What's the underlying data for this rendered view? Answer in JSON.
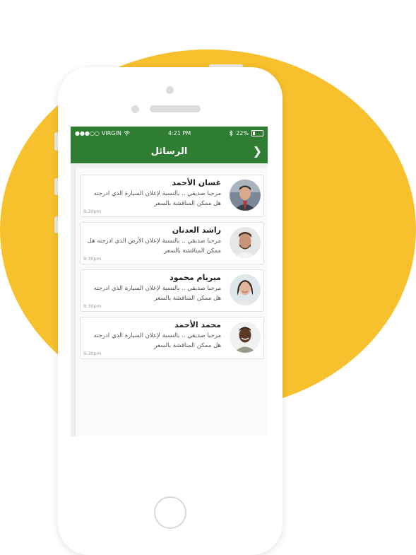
{
  "colors": {
    "accent": "#2e7d32",
    "background_circle": "#f6c12c"
  },
  "status_bar": {
    "signal": "●●●○○",
    "carrier": "VIRGIN",
    "wifi_icon": "wifi-icon",
    "time": "4:21 PM",
    "bluetooth_icon": "bluetooth-icon",
    "battery": "22%"
  },
  "navbar": {
    "title": "الرسائل",
    "back_icon": "chevron-right-icon"
  },
  "messages": [
    {
      "name": "غسان الأحمد",
      "text": "مرحبا صديقي .. بالنسبة لإعلان السيارة الذي ادرجته هل ممكن المناقشة بالسعر",
      "time": "9:30pm"
    },
    {
      "name": "راشد العدنان",
      "text": "مرحبا صديقي .. بالنسبة لإعلان الأرض الذي ادرجته هل ممكن المناقشة بالسعر",
      "time": "9:30pm"
    },
    {
      "name": "ميريام محمود",
      "text": "مرحبا صديقي .. بالنسبة لإعلان السيارة الذي ادرجته هل ممكن المناقشة بالسعر",
      "time": "9:30pm"
    },
    {
      "name": "محمد الأحمد",
      "text": "مرحبا صديقي .. بالنسبة لإعلان السيارة الذي ادرجته هل ممكن المناقشة بالسعر",
      "time": "9:30pm"
    }
  ]
}
